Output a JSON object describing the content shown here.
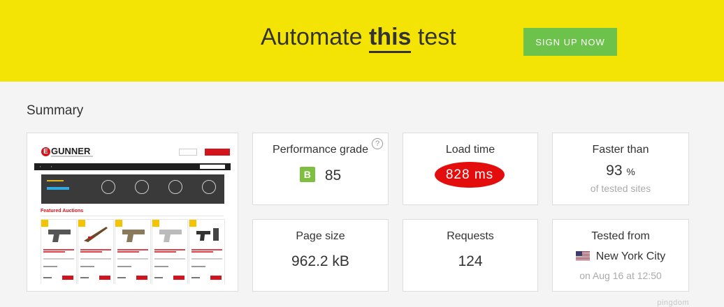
{
  "banner": {
    "headline_pre": "Automate",
    "headline_emph": "this",
    "headline_post": "test",
    "cta_label": "SIGN UP NOW"
  },
  "summary": {
    "title": "Summary",
    "performance": {
      "label": "Performance grade",
      "grade": "B",
      "score": "85",
      "help": "?"
    },
    "load_time": {
      "label": "Load time",
      "value": "828 ms"
    },
    "faster_than": {
      "label": "Faster than",
      "value": "93",
      "unit": "%",
      "sub": "of tested sites"
    },
    "page_size": {
      "label": "Page size",
      "value": "962.2 kB"
    },
    "requests": {
      "label": "Requests",
      "value": "124"
    },
    "tested_from": {
      "label": "Tested from",
      "location": "New York City",
      "date": "on Aug 16 at 12:50"
    }
  },
  "thumbnail": {
    "logo_text": "GUNNER",
    "logo_letter": "E",
    "featured_heading": "Featured Auctions"
  },
  "footer": {
    "watermark": "pingdom"
  },
  "colors": {
    "banner": "#f4e406",
    "cta": "#6cc24a",
    "grade_b": "#7fbf3f",
    "load_pill": "#e30d0d",
    "site_red": "#d2151d"
  },
  "icons": {
    "help": "question-circle-icon",
    "flag": "us-flag-icon"
  }
}
